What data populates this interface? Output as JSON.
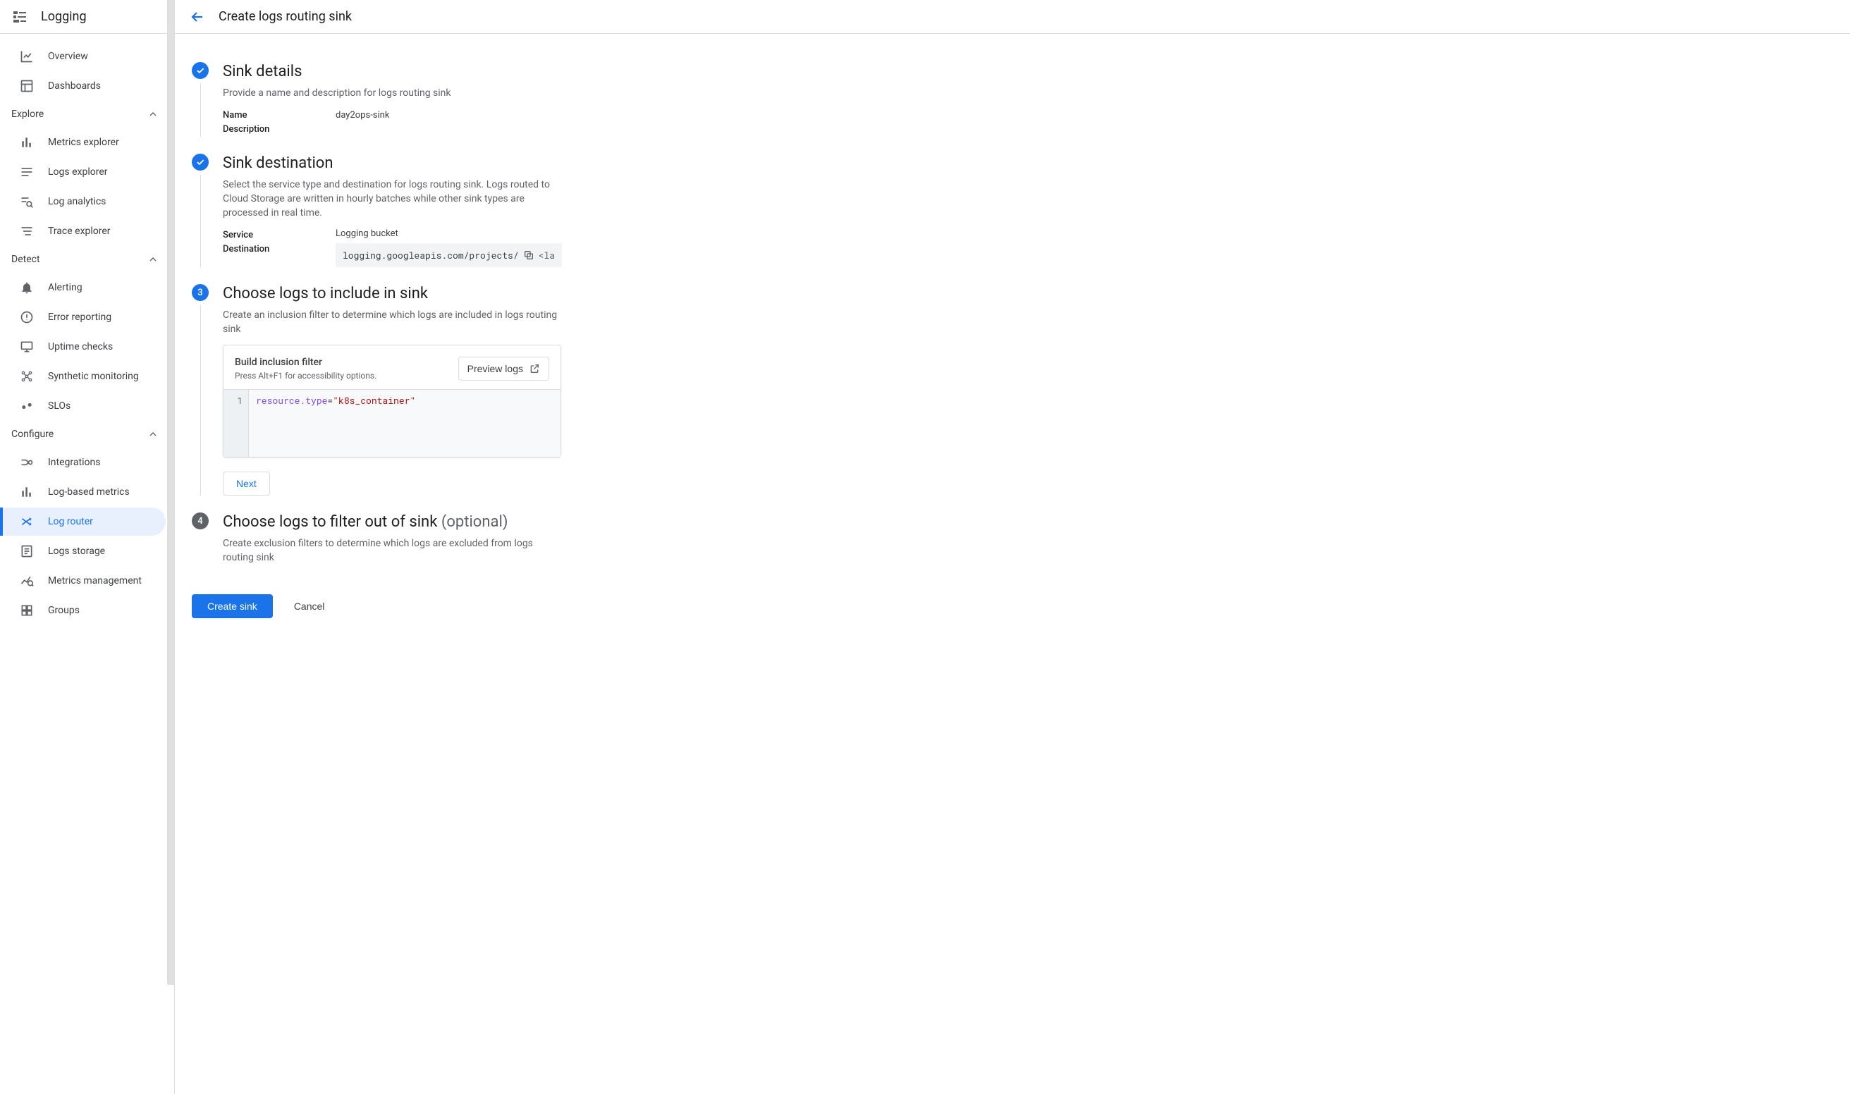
{
  "product": {
    "title": "Logging"
  },
  "nav": {
    "items": [
      {
        "label": "Overview"
      },
      {
        "label": "Dashboards"
      }
    ],
    "sections": [
      {
        "title": "Explore",
        "items": [
          {
            "label": "Metrics explorer"
          },
          {
            "label": "Logs explorer"
          },
          {
            "label": "Log analytics"
          },
          {
            "label": "Trace explorer"
          }
        ]
      },
      {
        "title": "Detect",
        "items": [
          {
            "label": "Alerting"
          },
          {
            "label": "Error reporting"
          },
          {
            "label": "Uptime checks"
          },
          {
            "label": "Synthetic monitoring"
          },
          {
            "label": "SLOs"
          }
        ]
      },
      {
        "title": "Configure",
        "items": [
          {
            "label": "Integrations"
          },
          {
            "label": "Log-based metrics"
          },
          {
            "label": "Log router",
            "active": true
          },
          {
            "label": "Logs storage"
          },
          {
            "label": "Metrics management"
          },
          {
            "label": "Groups"
          }
        ]
      }
    ]
  },
  "page": {
    "title": "Create logs routing sink",
    "steps": {
      "s1": {
        "title": "Sink details",
        "sub": "Provide a name and description for logs routing sink",
        "name_key": "Name",
        "name_val": "day2ops-sink",
        "desc_key": "Description",
        "desc_val": ""
      },
      "s2": {
        "title": "Sink destination",
        "sub": "Select the service type and destination for logs routing sink. Logs routed to Cloud Storage are written in hourly batches while other sink types are processed in real time.",
        "service_key": "Service",
        "service_val": "Logging bucket",
        "dest_key": "Destination",
        "dest_val": "logging.googleapis.com/projects/",
        "dest_tail": "<la"
      },
      "s3": {
        "num": "3",
        "title": "Choose logs to include in sink",
        "sub": "Create an inclusion filter to determine which logs are included in logs routing sink",
        "editor_title": "Build inclusion filter",
        "editor_hint": "Press Alt+F1 for accessibility options.",
        "preview": "Preview logs",
        "line1_num": "1",
        "filter_key": "resource.type",
        "filter_eq": "=",
        "filter_val": "\"k8s_container\"",
        "next": "Next"
      },
      "s4": {
        "num": "4",
        "title": "Choose logs to filter out of sink ",
        "opt": "(optional)",
        "sub": "Create exclusion filters to determine which logs are excluded from logs routing sink"
      }
    },
    "cta": {
      "create": "Create sink",
      "cancel": "Cancel"
    }
  }
}
